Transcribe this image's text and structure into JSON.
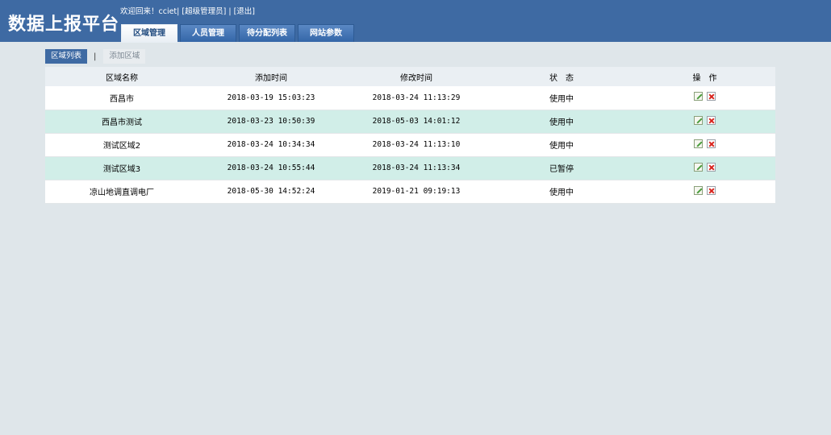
{
  "header": {
    "logo": "数据上报平台",
    "welcome": "欢迎回来！cciet|",
    "role": "[超级管理员]",
    "divider": "|",
    "logout": "[退出]"
  },
  "nav": {
    "tabs": [
      {
        "label": "区域管理",
        "active": true
      },
      {
        "label": "人员管理",
        "active": false
      },
      {
        "label": "待分配列表",
        "active": false
      },
      {
        "label": "网站参数",
        "active": false
      }
    ]
  },
  "subtabs": {
    "list_label": "区域列表",
    "separator": "|",
    "add_label": "添加区域"
  },
  "table": {
    "headers": [
      "区域名称",
      "添加时间",
      "修改时间",
      "状　态",
      "操　作"
    ],
    "rows": [
      {
        "name": "西昌市",
        "added": "2018-03-19 15:03:23",
        "modified": "2018-03-24 11:13:29",
        "status": "使用中"
      },
      {
        "name": "西昌市测试",
        "added": "2018-03-23 10:50:39",
        "modified": "2018-05-03 14:01:12",
        "status": "使用中"
      },
      {
        "name": "测试区域2",
        "added": "2018-03-24 10:34:34",
        "modified": "2018-03-24 11:13:10",
        "status": "使用中"
      },
      {
        "name": "测试区域3",
        "added": "2018-03-24 10:55:44",
        "modified": "2018-03-24 11:13:34",
        "status": "已暂停"
      },
      {
        "name": "凉山地调直调电厂",
        "added": "2018-05-30 14:52:24",
        "modified": "2019-01-21 09:19:13",
        "status": "使用中"
      }
    ],
    "icons": {
      "edit": "edit-icon",
      "delete": "delete-icon"
    }
  },
  "colors": {
    "header_bg": "#3e6aa3",
    "row_alt": "#d1eee8",
    "page_bg": "#dfe6ea"
  }
}
